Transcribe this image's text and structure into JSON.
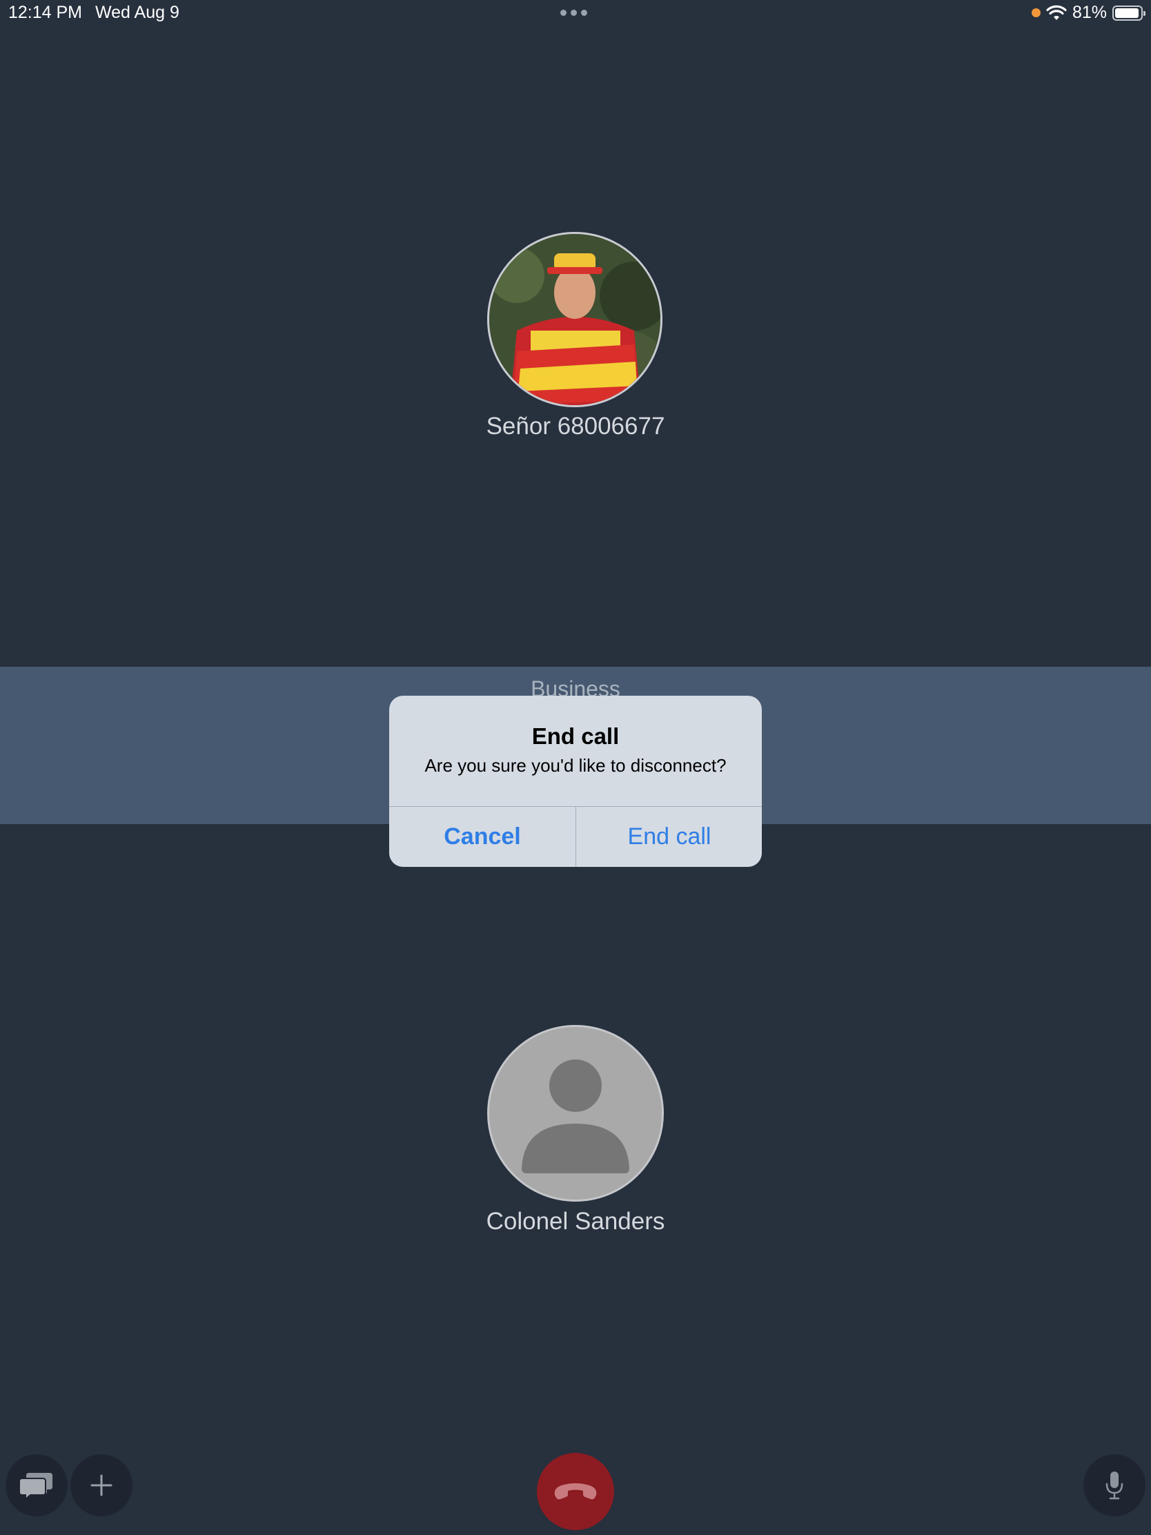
{
  "status_bar": {
    "time": "12:14 PM",
    "date": "Wed Aug 9",
    "battery_percent": "81%",
    "battery_level": 0.81,
    "indicator_color": "#f0973a"
  },
  "participants": {
    "top": {
      "name": "Señor 68006677",
      "avatar": "photo-avatar"
    },
    "bottom": {
      "name": "Colonel Sanders",
      "avatar": "person-placeholder-icon"
    }
  },
  "band": {
    "label": "Business"
  },
  "dialog": {
    "title": "End call",
    "message": "Are you sure you'd like to disconnect?",
    "cancel_label": "Cancel",
    "confirm_label": "End call",
    "button_color": "#2f7ee6"
  },
  "controls": {
    "chat_icon": "chat-bubbles-icon",
    "add_icon": "plus-icon",
    "hangup_icon": "phone-hangup-icon",
    "hangup_color": "#8c1c22",
    "mic_icon": "microphone-icon"
  }
}
